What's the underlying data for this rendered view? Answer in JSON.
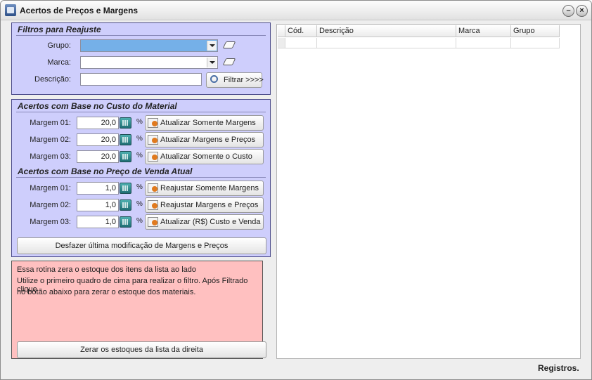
{
  "window": {
    "title": "Acertos de Preços e Margens",
    "minimize_symbol": "–",
    "close_symbol": "×"
  },
  "filters": {
    "title": "Filtros para Reajuste",
    "grupo_label": "Grupo:",
    "grupo_value": "",
    "marca_label": "Marca:",
    "marca_value": "",
    "descricao_label": "Descrição:",
    "descricao_value": "",
    "filter_button": "Filtrar >>>>"
  },
  "cost_section": {
    "title": "Acertos com Base no Custo do Material",
    "rows": [
      {
        "label": "Margem 01:",
        "value": "20,0",
        "unit": "%",
        "button": "Atualizar Somente Margens"
      },
      {
        "label": "Margem 02:",
        "value": "20,0",
        "unit": "%",
        "button": "Atualizar Margens e Preços"
      },
      {
        "label": "Margem 03:",
        "value": "20,0",
        "unit": "%",
        "button": "Atualizar Somente o Custo"
      }
    ]
  },
  "price_section": {
    "title": "Acertos com Base no Preço de Venda Atual",
    "rows": [
      {
        "label": "Margem 01:",
        "value": "1,0",
        "unit": "%",
        "button": "Reajustar Somente Margens"
      },
      {
        "label": "Margem 02:",
        "value": "1,0",
        "unit": "%",
        "button": "Reajustar Margens e Preços"
      },
      {
        "label": "Margem 03:",
        "value": "1,0",
        "unit": "%",
        "button": "Atualizar (R$) Custo e Venda"
      }
    ],
    "undo_button": "Desfazer última modificação de Margens e Preços"
  },
  "note": {
    "lines": [
      "Essa rotina zera o estoque dos itens da lista ao lado",
      "Utilize o primeiro quadro de cima para realizar o filtro. Após Filtrado clique",
      "no botão abaixo para zerar o estoque dos materiais."
    ],
    "button": "Zerar os estoques da lista da direita"
  },
  "grid": {
    "columns": [
      "Cód.",
      "Descrição",
      "Marca",
      "Grupo"
    ]
  },
  "status": {
    "registros": "Registros."
  },
  "colors": {
    "panel": "#cecefc",
    "note": "#ffc0c0",
    "selected_field": "#75b0e8"
  }
}
